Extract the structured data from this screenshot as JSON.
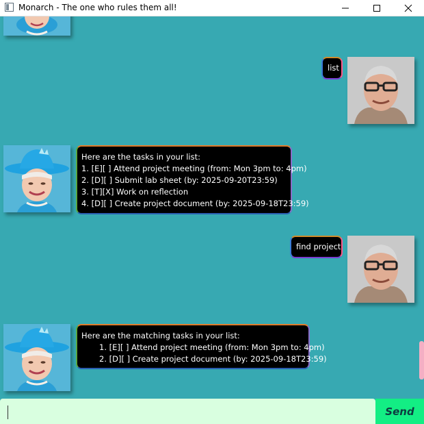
{
  "window": {
    "title": "Monarch - The one who rules them all!",
    "controls": [
      "minimize-icon",
      "maximize-icon",
      "close-icon"
    ]
  },
  "chat": {
    "messages": [
      {
        "sender": "user",
        "lines": [
          "list"
        ]
      },
      {
        "sender": "monarch",
        "lines": [
          "Here are the tasks in your list:",
          "1. [E][ ] Attend project meeting (from: Mon 3pm to: 4pm)",
          "2. [D][ ] Submit lab sheet (by: 2025-09-20T23:59)",
          "3. [T][X] Work on reflection",
          "4. [D][ ] Create project document (by: 2025-09-18T23:59)"
        ]
      },
      {
        "sender": "user",
        "lines": [
          "find project"
        ]
      },
      {
        "sender": "monarch",
        "lines": [
          "Here are the matching tasks in your list:",
          "1. [E][ ] Attend project meeting (from: Mon 3pm to: 4pm)",
          "2. [D][ ] Create project document (by: 2025-09-18T23:59)"
        ]
      }
    ]
  },
  "input": {
    "value": "",
    "placeholder": ""
  },
  "send_button": {
    "label": "Send"
  },
  "colors": {
    "background": "#37A9B2",
    "bubble": "#000000",
    "input_background": "#D9FFE0",
    "send_background": "#13EE84",
    "scrollbar": "#F4AFC4"
  }
}
